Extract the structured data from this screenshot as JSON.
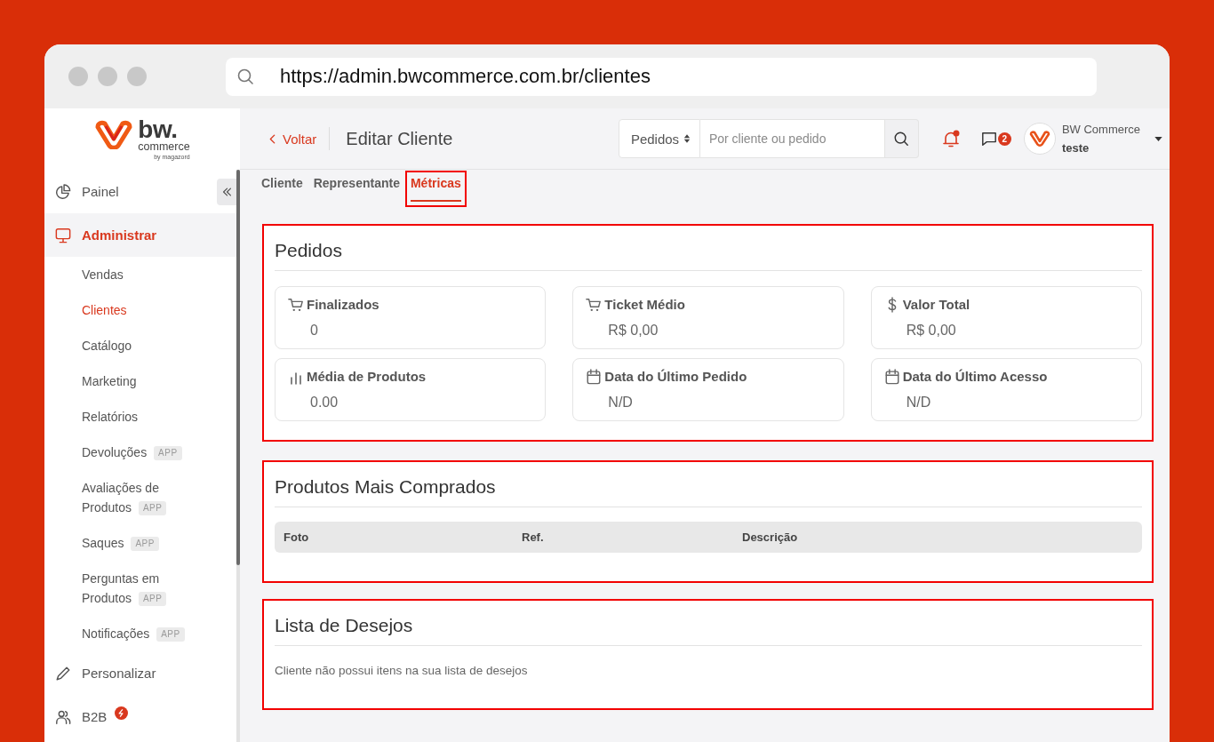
{
  "browser": {
    "url": "https://admin.bwcommerce.com.br/clientes"
  },
  "logo": {
    "wordmark": "bw.",
    "tagline": "commerce",
    "byline": "by magazord"
  },
  "header": {
    "back_link": "Voltar",
    "title": "Editar Cliente",
    "search": {
      "scope": "Pedidos",
      "placeholder": "Por cliente ou pedido"
    },
    "notifications": {
      "unread": true
    },
    "messages": {
      "count": "2"
    },
    "user": {
      "name": "BW Commerce",
      "store": "teste"
    }
  },
  "sidebar": {
    "items": [
      {
        "label": "Painel",
        "selected": false,
        "new": false
      },
      {
        "label": "Administrar",
        "selected": true,
        "new": false,
        "children": [
          {
            "label": "Vendas",
            "selected": false
          },
          {
            "label": "Clientes",
            "selected": true
          },
          {
            "label": "Catálogo",
            "selected": false
          },
          {
            "label": "Marketing",
            "selected": false
          },
          {
            "label": "Relatórios",
            "selected": false
          },
          {
            "label": "Devoluções",
            "selected": false,
            "badge": "APP"
          },
          {
            "label": "Avaliações de Produtos",
            "selected": false,
            "badge": "APP"
          },
          {
            "label": "Saques",
            "selected": false,
            "badge": "APP"
          },
          {
            "label": "Perguntas em Produtos",
            "selected": false,
            "badge": "APP"
          },
          {
            "label": "Notificações",
            "selected": false,
            "badge": "APP"
          }
        ]
      },
      {
        "label": "Personalizar",
        "selected": false,
        "new": false
      },
      {
        "label": "B2B",
        "selected": false,
        "new": true
      }
    ]
  },
  "tabs": [
    {
      "label": "Cliente",
      "selected": false,
      "highlighted": false
    },
    {
      "label": "Representante",
      "selected": false,
      "highlighted": false
    },
    {
      "label": "Métricas",
      "selected": true,
      "highlighted": true
    }
  ],
  "sections": {
    "orders": {
      "title": "Pedidos",
      "highlighted": true,
      "metrics": [
        {
          "label": "Finalizados",
          "value": "0"
        },
        {
          "label": "Ticket Médio",
          "value": "R$ 0,00"
        },
        {
          "label": "Valor Total",
          "value": "R$ 0,00"
        },
        {
          "label": "Média de Produtos",
          "value": "0.00"
        },
        {
          "label": "Data do Último Pedido",
          "value": "N/D"
        },
        {
          "label": "Data do Último Acesso",
          "value": "N/D"
        }
      ]
    },
    "top_products": {
      "title": "Produtos Mais Comprados",
      "highlighted": true,
      "table": {
        "columns": [
          "Foto",
          "Ref.",
          "Descrição"
        ]
      }
    },
    "wishlist": {
      "title": "Lista de Desejos",
      "highlighted": true,
      "empty_message": "Cliente não possui itens na sua lista de desejos"
    }
  }
}
